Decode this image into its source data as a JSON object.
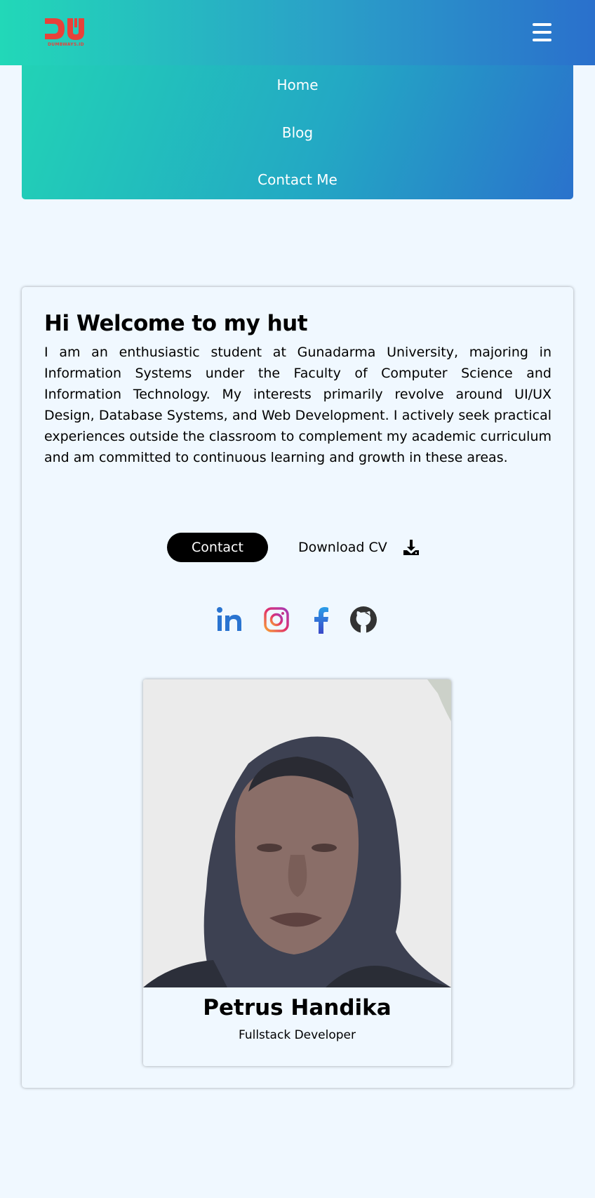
{
  "brand": {
    "logo_text": "DUMBWAYS.ID",
    "logo_icon": "dumbways-logo",
    "color": "#e8413a"
  },
  "header": {
    "menu_icon": "hamburger-icon",
    "gradient": [
      "#22d8b8",
      "#2a70cc"
    ]
  },
  "nav": {
    "items": [
      {
        "label": "Home"
      },
      {
        "label": "Blog"
      },
      {
        "label": "Contact Me"
      }
    ]
  },
  "hero": {
    "title": "Hi Welcome to my hut",
    "description": "I am an enthusiastic student at Gunadarma University, majoring in Information Systems under the Faculty of Computer Science and Information Technology. My interests primarily revolve around UI/UX Design, Database Systems, and Web Development. I actively seek practical experiences outside the classroom to complement my academic curriculum and am committed to continuous learning and growth in these areas.",
    "contact_label": "Contact",
    "download_label": "Download CV",
    "download_icon": "download-icon"
  },
  "social": [
    {
      "name": "linkedin-icon",
      "color": "#2a74d0"
    },
    {
      "name": "instagram-icon",
      "color": "#e1306c"
    },
    {
      "name": "facebook-icon",
      "color": "#3b5acc"
    },
    {
      "name": "github-icon",
      "color": "#333333"
    }
  ],
  "profile": {
    "name": "Petrus Handika",
    "role": "Fullstack Developer"
  },
  "colors": {
    "page_bg": "#f0f8ff",
    "button_bg": "#000000"
  }
}
